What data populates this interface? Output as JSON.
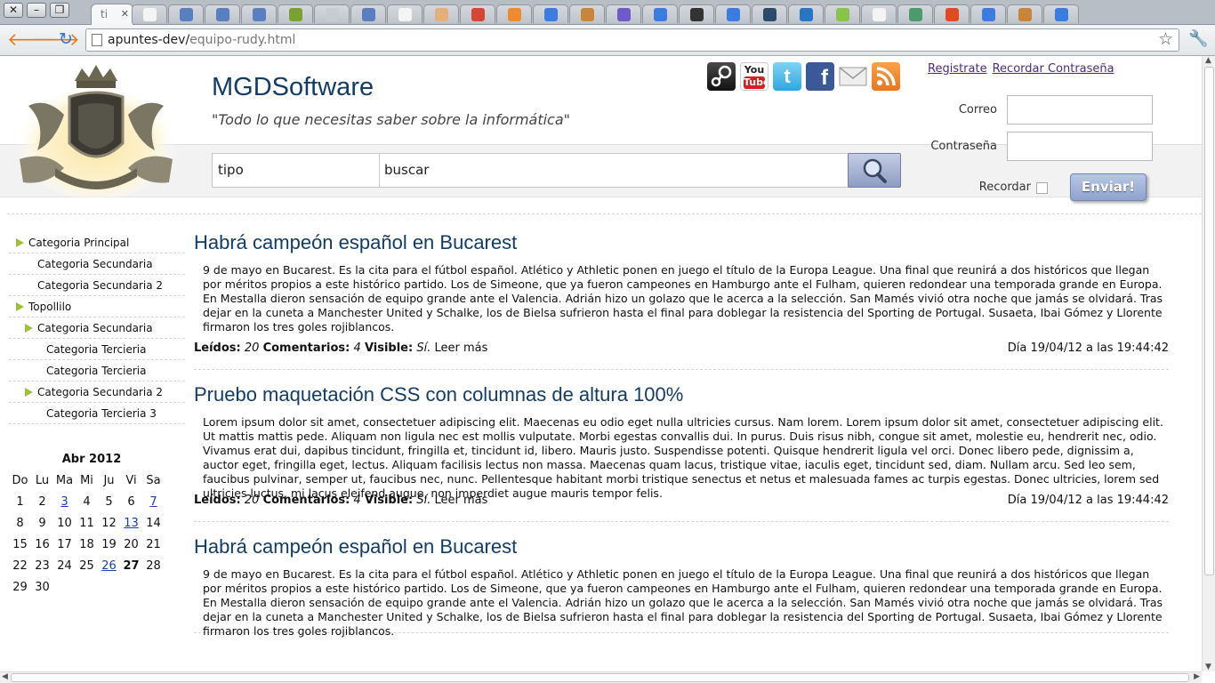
{
  "browser": {
    "active_tab_title": "ti",
    "url_host": "apuntes-dev/",
    "url_path": "equipo-rudy.html",
    "tab_icons": [
      "page-icon",
      "wrench-icon",
      "wrench-icon",
      "wrench-icon",
      "uni-icon",
      "blank-icon",
      "wrench-icon",
      "page-icon",
      "palette-icon",
      "gmail-icon",
      "orange-icon",
      "google-icon",
      "stack-icon",
      "chrome-icon",
      "google-icon",
      "v-icon",
      "google-icon",
      "r-icon",
      "ext-icon",
      "leaf-icon",
      "page-icon",
      "ilc-icon",
      "fire-icon",
      "google-icon",
      "stack-icon",
      "google-icon"
    ]
  },
  "header": {
    "site_title": "MGDSoftware",
    "tagline": "\"Todo lo que necesitas saber sobre la informática\"",
    "social_icons": [
      "steam-icon",
      "youtube-icon",
      "twitter-icon",
      "facebook-icon",
      "mail-icon",
      "rss-icon"
    ],
    "youtube_text": "You Tube"
  },
  "login": {
    "register_link": "Registrate",
    "remember_password_link": "Recordar Contraseña",
    "email_label": "Correo",
    "password_label": "Contraseña",
    "remember_label": "Recordar",
    "submit_label": "Enviar!"
  },
  "search": {
    "type_value": "tipo",
    "query_value": "buscar"
  },
  "sidebar": {
    "items": [
      {
        "label": "Categoria Principal",
        "level": 0,
        "arrow": true
      },
      {
        "label": "Categoria Secundaria",
        "level": 1,
        "arrow": false
      },
      {
        "label": "Categoria Secundaria 2",
        "level": 1,
        "arrow": false
      },
      {
        "label": "Topollilo",
        "level": 0,
        "arrow": true
      },
      {
        "label": "Categoria Secundaria",
        "level": 1,
        "arrow": true
      },
      {
        "label": "Categoria Tercieria",
        "level": 2,
        "arrow": false
      },
      {
        "label": "Categoria Tercieria",
        "level": 2,
        "arrow": false
      },
      {
        "label": "Categoria Secundaria 2",
        "level": 1,
        "arrow": true
      },
      {
        "label": "Categoria Tercieria 3",
        "level": 2,
        "arrow": false
      }
    ]
  },
  "calendar": {
    "title": "Abr 2012",
    "weekdays": [
      "Do",
      "Lu",
      "Ma",
      "Mi",
      "Ju",
      "Vi",
      "Sa"
    ],
    "weeks": [
      [
        "1",
        "2",
        "3",
        "4",
        "5",
        "6",
        "7"
      ],
      [
        "8",
        "9",
        "10",
        "11",
        "12",
        "13",
        "14"
      ],
      [
        "15",
        "16",
        "17",
        "18",
        "19",
        "20",
        "21"
      ],
      [
        "22",
        "23",
        "24",
        "25",
        "26",
        "27",
        "28"
      ],
      [
        "29",
        "30",
        "",
        "",
        "",
        "",
        ""
      ]
    ],
    "linked_days": [
      "3",
      "7",
      "13",
      "26"
    ],
    "today": "27"
  },
  "posts": [
    {
      "title": "Habrá campeón español en Bucarest",
      "body": "9 de mayo en Bucarest. Es la cita para el fútbol español. Atlético y Athletic ponen en juego el título de la Europa League. Una final que reunirá a dos históricos que llegan por méritos propios a este histórico partido. Los de Simeone, que ya fueron campeones en Hamburgo ante el Fulham, quieren redondear una temporada grande en Europa. En Mestalla dieron sensación de equipo grande ante el Valencia. Adrián hizo un golazo que le acerca a la selección. San Mamés vivió otra noche que jamás se olvidará. Tras dejar en la cuneta a Manchester United y Schalke, los de Bielsa sufrieron hasta el final para doblegar la resistencia del Sporting de Portugal. Susaeta, Ibai Gómez y Llorente firmaron los tres goles rojiblancos.",
      "reads_label": "Leídos:",
      "reads": "20",
      "comments_label": "Comentarios:",
      "comments": "4",
      "visible_label": "Visible:",
      "visible": "Sí.",
      "more": "Leer más",
      "date": "Día 19/04/12 a las 19:44:42"
    },
    {
      "title": "Pruebo maquetación CSS con columnas de altura 100%",
      "body": "Lorem ipsum dolor sit amet, consectetuer adipiscing elit. Maecenas eu odio eget nulla ultricies cursus. Nam lorem. Lorem ipsum dolor sit amet, consectetuer adipiscing elit. Ut mattis mattis pede. Aliquam non ligula nec est mollis vulputate. Morbi egestas convallis dui. In purus. Duis risus nibh, congue sit amet, molestie eu, hendrerit nec, odio. Vivamus erat dui, dapibus tincidunt, fringilla et, tincidunt id, libero. Mauris justo. Suspendisse potenti. Quisque hendrerit ligula vel orci. Donec libero pede, dignissim a, auctor eget, fringilla eget, lectus. Aliquam facilisis lectus non massa. Maecenas quam lacus, tristique vitae, iaculis eget, tincidunt sed, diam. Nullam arcu. Sed leo sem, faucibus pulvinar, semper ut, faucibus nec, nunc. Pellentesque habitant morbi tristique senectus et netus et malesuada fames ac turpis egestas. Donec ultricies, lorem sed ultricies luctus, mi lacus eleifend augue, non imperdiet augue mauris tempor felis.",
      "reads_label": "Leídos:",
      "reads": "20",
      "comments_label": "Comentarios:",
      "comments": "4",
      "visible_label": "Visible:",
      "visible": "Sí.",
      "more": "Leer más",
      "date": "Día 19/04/12 a las 19:44:42"
    },
    {
      "title": "Habrá campeón español en Bucarest",
      "body": "9 de mayo en Bucarest. Es la cita para el fútbol español. Atlético y Athletic ponen en juego el título de la Europa League. Una final que reunirá a dos históricos que llegan por méritos propios a este histórico partido. Los de Simeone, que ya fueron campeones en Hamburgo ante el Fulham, quieren redondear una temporada grande en Europa. En Mestalla dieron sensación de equipo grande ante el Valencia. Adrián hizo un golazo que le acerca a la selección. San Mamés vivió otra noche que jamás se olvidará. Tras dejar en la cuneta a Manchester United y Schalke, los de Bielsa sufrieron hasta el final para doblegar la resistencia del Sporting de Portugal. Susaeta, Ibai Gómez y Llorente firmaron los tres goles rojiblancos."
    }
  ],
  "colors": {
    "title_blue": "#123d68",
    "link_purple": "#4b2a8a",
    "calendar_link": "#1a3fb0",
    "arrow_green": "#9bc03a"
  }
}
